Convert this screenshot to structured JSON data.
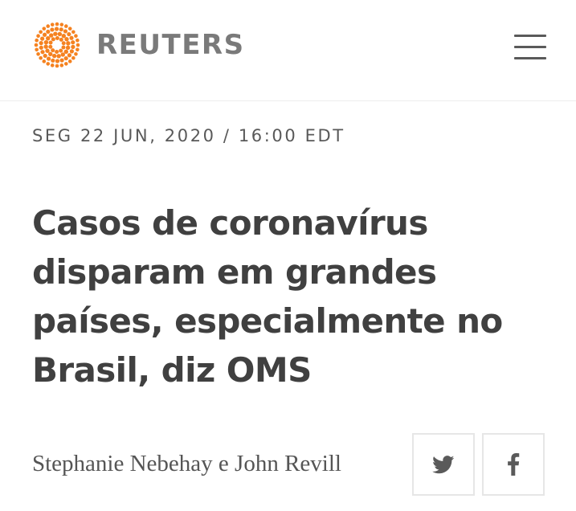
{
  "header": {
    "brand": "REUTERS",
    "logo_icon": "reuters-dot-logo",
    "menu_icon": "hamburger-menu-icon",
    "brand_color": "#f58220"
  },
  "article": {
    "dateline": "SEG 22 JUN, 2020 / 16:00 EDT",
    "headline": "Casos de coronavírus disparam em grandes países, especialmente no Brasil, diz OMS",
    "byline": "Stephanie Nebehay e John Revill"
  },
  "share": {
    "twitter_icon": "twitter-icon",
    "facebook_icon": "facebook-icon",
    "icon_color": "#5a5a5a"
  }
}
